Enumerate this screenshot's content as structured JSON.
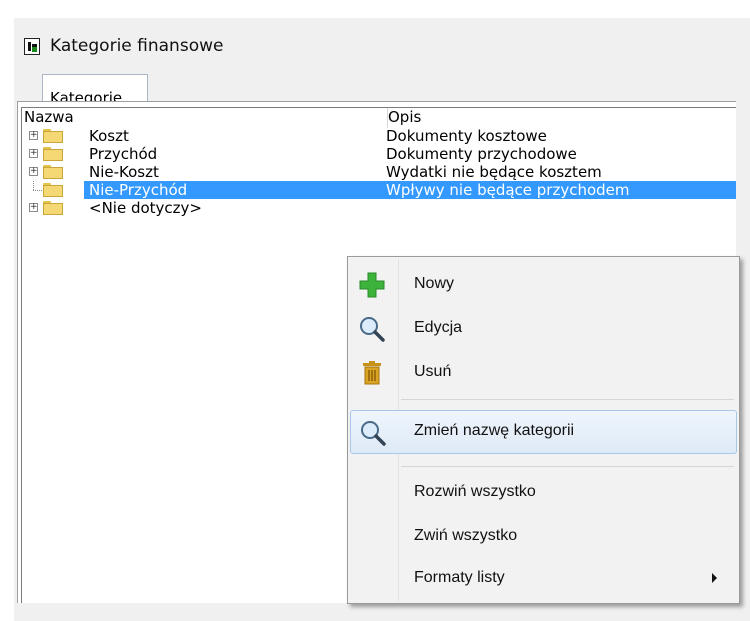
{
  "window": {
    "title": "Kategorie finansowe"
  },
  "tabs": [
    {
      "label": "Kategorie"
    }
  ],
  "tree": {
    "columns": [
      "Nazwa",
      "Opis"
    ],
    "rows": [
      {
        "name": "Koszt",
        "desc": "Dokumenty kosztowe",
        "expandable": true
      },
      {
        "name": "Przychód",
        "desc": "Dokumenty przychodowe",
        "expandable": true
      },
      {
        "name": "Nie-Koszt",
        "desc": "Wydatki nie będące kosztem",
        "expandable": true
      },
      {
        "name": "Nie-Przychód",
        "desc": "Wpływy nie będące przychodem",
        "expandable": false,
        "selected": true
      },
      {
        "name": "<Nie dotyczy>",
        "desc": "",
        "expandable": true
      }
    ]
  },
  "context_menu": {
    "items": [
      {
        "label": "Nowy",
        "icon": "plus-icon"
      },
      {
        "label": "Edycja",
        "icon": "magnifier-icon"
      },
      {
        "label": "Usuń",
        "icon": "trash-icon"
      },
      {
        "label": "Zmień nazwę kategorii",
        "icon": "magnifier-icon",
        "highlighted": true
      },
      {
        "label": "Rozwiń wszystko"
      },
      {
        "label": "Zwiń wszystko"
      },
      {
        "label": "Formaty listy",
        "submenu": true
      }
    ]
  },
  "colors": {
    "selection": "#3399ff",
    "plus_icon": "#3cb43c",
    "trash_icon": "#c7921a"
  }
}
